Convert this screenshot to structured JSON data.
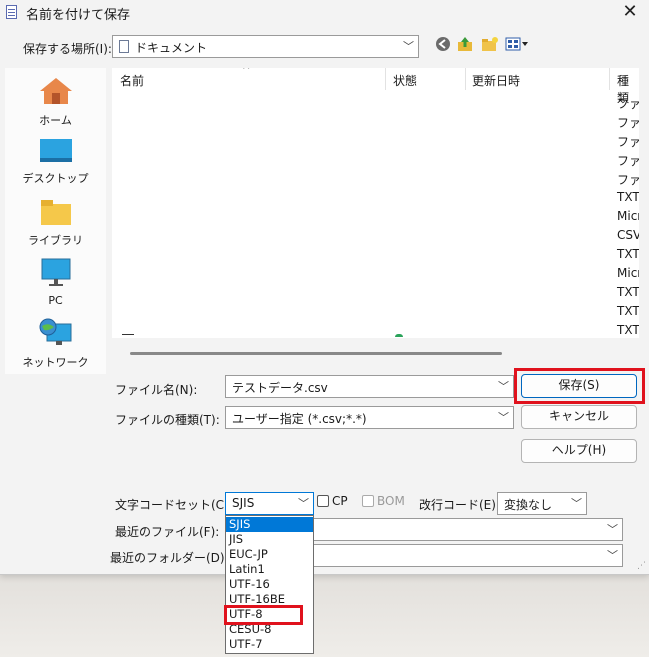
{
  "window": {
    "title": "名前を付けて保存",
    "close_glyph": "✕"
  },
  "location": {
    "label": "保存する場所(I):",
    "folder": "ドキュメント"
  },
  "places": [
    {
      "label": "ホーム",
      "icon": "home-icon"
    },
    {
      "label": "デスクトップ",
      "icon": "desktop-icon"
    },
    {
      "label": "ライブラリ",
      "icon": "library-folder-icon"
    },
    {
      "label": "PC",
      "icon": "pc-monitor-icon"
    },
    {
      "label": "ネットワーク",
      "icon": "network-icon"
    }
  ],
  "file_list": {
    "columns": [
      "名前",
      "状態",
      "更新日時",
      "種類"
    ],
    "types": [
      "ファイ",
      "ファイ",
      "ファイ",
      "ファイ",
      "ファイ",
      "TXT",
      "Micr",
      "CSV",
      "TXT",
      "Micr",
      "TXT",
      "TXT",
      "TXT"
    ]
  },
  "filename": {
    "label": "ファイル名(N):",
    "value": "テストデータ.csv"
  },
  "filetype": {
    "label": "ファイルの種類(T):",
    "value": "ユーザー指定 (*.csv;*.*)"
  },
  "buttons": {
    "save": "保存(S)",
    "cancel": "キャンセル",
    "help": "ヘルプ(H)"
  },
  "options": {
    "charset_label": "文字コードセット(C):",
    "charset_value": "SJIS",
    "cp_label": "CP",
    "bom_label": "BOM",
    "newline_label": "改行コード(E):",
    "newline_value": "変換なし"
  },
  "recent": {
    "files_label": "最近のファイル(F):",
    "folders_label": "最近のフォルダー(D):"
  },
  "charset_options": [
    "SJIS",
    "JIS",
    "EUC-JP",
    "Latin1",
    "UTF-16",
    "UTF-16BE",
    "UTF-8",
    "CESU-8",
    "UTF-7"
  ],
  "colors": {
    "selection": "#0078d7",
    "highlight_box": "#e0121d",
    "accent_border": "#0067c0"
  }
}
